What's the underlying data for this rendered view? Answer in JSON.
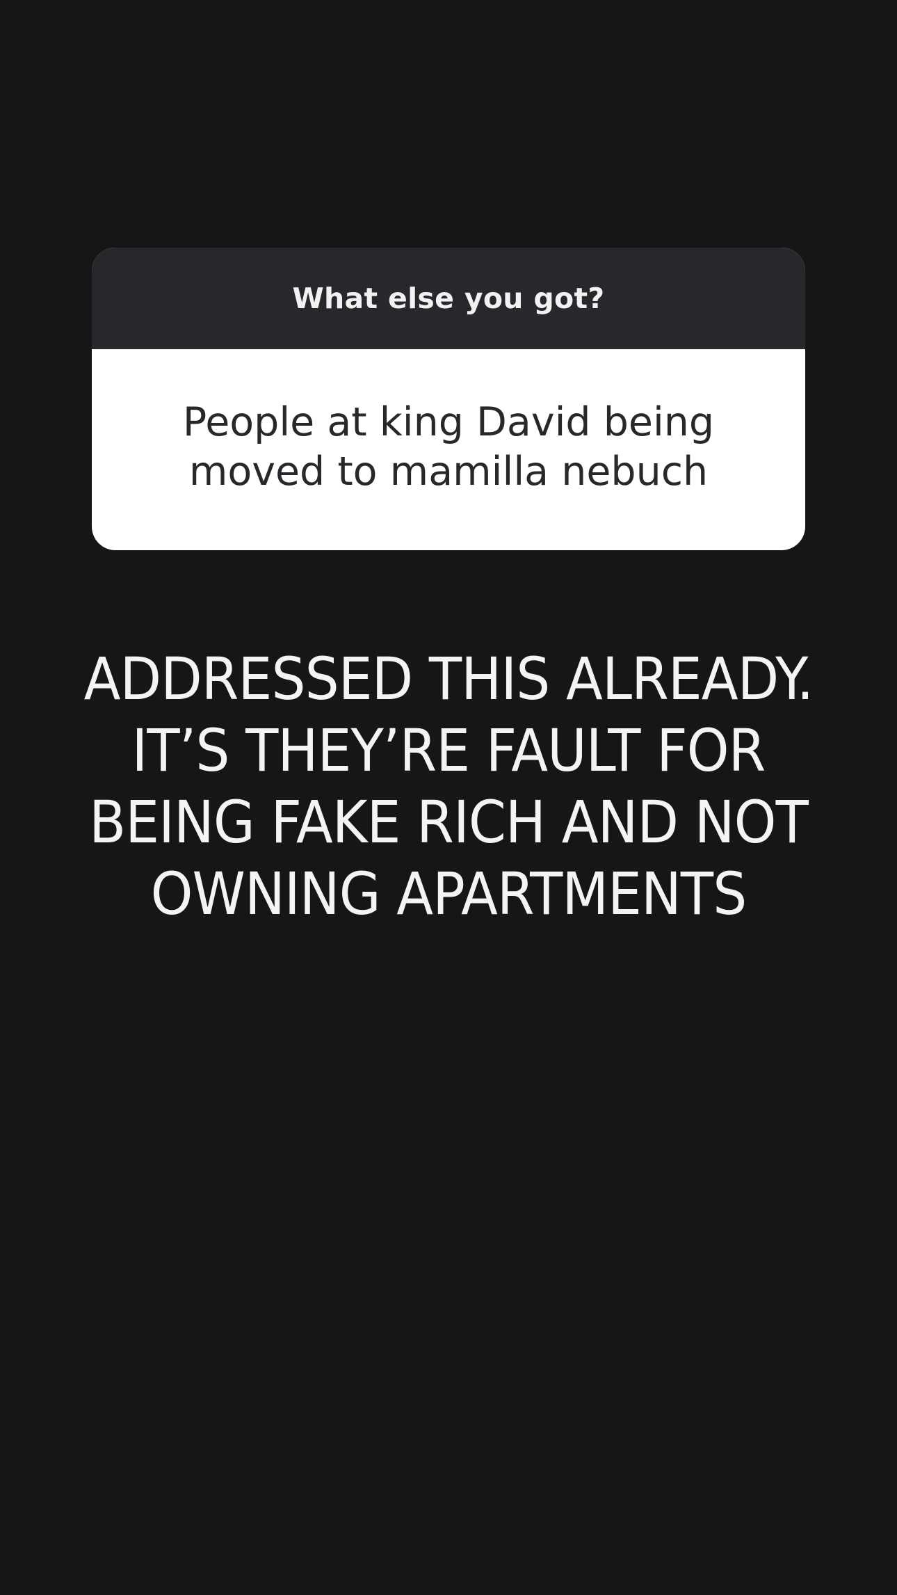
{
  "question_card": {
    "prompt": "What else you got?",
    "answer": "People at king David being moved to mamilla nebuch"
  },
  "caption": {
    "text": "ADDRESSED THIS ALREADY. IT’S THEY’RE FAULT FOR BEING FAKE RICH AND NOT OWNING APARTMENTS"
  }
}
